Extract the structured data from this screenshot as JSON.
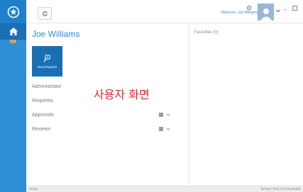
{
  "header": {
    "welcome_text": "Welcome, Joe Williams"
  },
  "main": {
    "user_name": "Joe Williams",
    "tile_label": "New Request",
    "nav": [
      {
        "label": "Administrator"
      },
      {
        "label": "Requests"
      },
      {
        "label": "Approvals"
      },
      {
        "label": "Reviews"
      }
    ],
    "overlay_text": "사용자 화면"
  },
  "favorites": {
    "label": "Favorites (0)"
  },
  "status": {
    "left": "Home",
    "right": "Service 70.0.0.3 Connected"
  },
  "colors": {
    "accent": "#2e8fd6",
    "accent_dark": "#1a6fb3",
    "overlay": "#e0262b"
  },
  "icons": {
    "logo": "app-logo-icon",
    "home": "home-icon",
    "refresh": "refresh-icon",
    "settings": "gear-icon",
    "tile": "new-request-icon"
  }
}
